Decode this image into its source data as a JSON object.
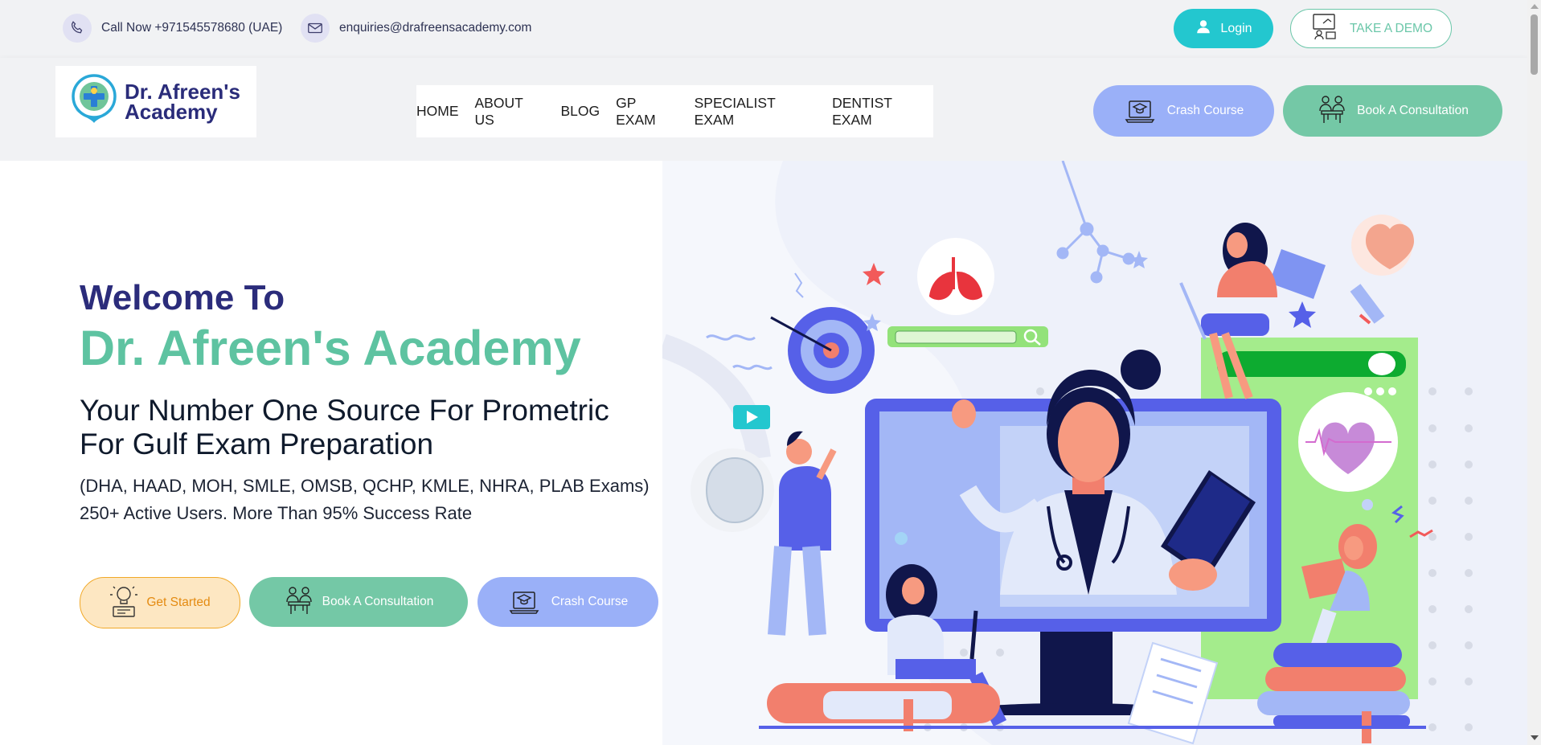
{
  "topbar": {
    "phone": "Call Now +971545578680 (UAE)",
    "email": "enquiries@drafreensacademy.com",
    "login_label": "Login",
    "demo_label": "TAKE A DEMO"
  },
  "header": {
    "logo_line1": "Dr. Afreen's",
    "logo_line2": "Academy",
    "nav": [
      "HOME",
      "ABOUT US",
      "BLOG",
      "GP EXAM",
      "SPECIALIST EXAM",
      "DENTIST EXAM"
    ],
    "crash_label": "Crash Course",
    "book_label": "Book A Consultation"
  },
  "hero": {
    "welcome": "Welcome To",
    "academy": "Dr. Afreen's Academy",
    "tagline": "Your Number One Source For Prometric For Gulf Exam Preparation",
    "exams": "(DHA, HAAD, MOH, SMLE, OMSB, QCHP, KMLE, NHRA, PLAB Exams)",
    "users": "250+ Active Users. More Than 95% Success Rate",
    "get_started_label": "Get Started",
    "book_label": "Book A Consultation",
    "crash_label": "Crash Course"
  },
  "colors": {
    "navy": "#2b2c7b",
    "mint": "#5ec3a1",
    "teal": "#23c7cf",
    "periwinkle": "#9ab0f8",
    "green_button": "#74c8a6",
    "orange": "#f1a827"
  },
  "icons": {
    "phone": "phone-icon",
    "email": "email-icon",
    "user": "user-icon",
    "demo": "presentation-icon",
    "crash": "laptop-graduation-icon",
    "book": "consultation-icon",
    "start": "idea-icon"
  }
}
